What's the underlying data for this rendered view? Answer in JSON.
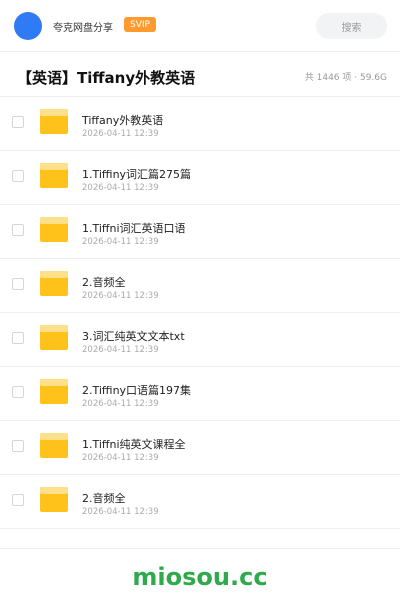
{
  "header": {
    "brand": "夸克网盘分享",
    "badge": "SVIP",
    "search_label": "搜索"
  },
  "title_bar": {
    "title": "【英语】Tiffany外教英语",
    "meta": "共 1446 项 · 59.6G"
  },
  "files": [
    {
      "name": "Tiffany外教英语",
      "date": "2026-04-11 12:39"
    },
    {
      "name": "1.Tiffiny词汇篇275篇",
      "date": "2026-04-11 12:39"
    },
    {
      "name": "1.Tiffni词汇英语口语",
      "date": "2026-04-11 12:39"
    },
    {
      "name": "2.音频全",
      "date": "2026-04-11 12:39"
    },
    {
      "name": "3.词汇纯英文文本txt",
      "date": "2026-04-11 12:39"
    },
    {
      "name": "2.Tiffiny口语篇197集",
      "date": "2026-04-11 12:39"
    },
    {
      "name": "1.Tiffni纯英文课程全",
      "date": "2026-04-11 12:39"
    },
    {
      "name": "2.音频全",
      "date": "2026-04-11 12:39"
    }
  ],
  "watermark": "miosou.cc",
  "colors": {
    "avatar": "#2f7bf6",
    "badge": "#ff9a2e",
    "folder": "#ffc21a",
    "folder_tab": "#ffe08a",
    "watermark": "#2eaa4b"
  },
  "icons": {
    "folder": "folder-icon",
    "checkbox": "checkbox-icon"
  }
}
